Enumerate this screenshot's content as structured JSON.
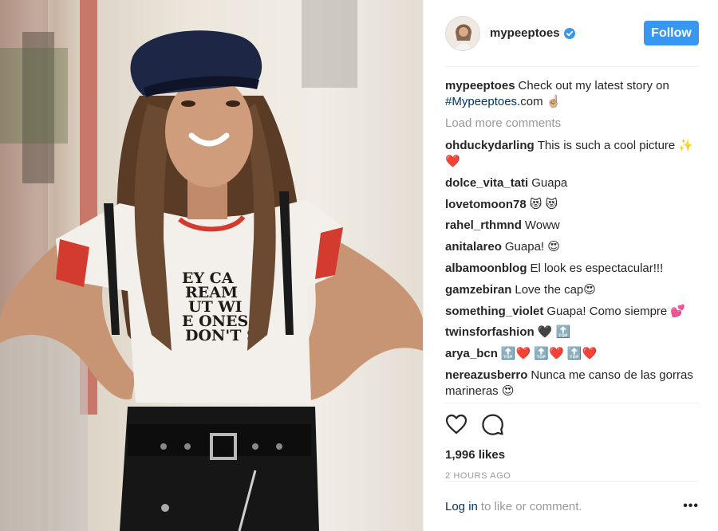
{
  "post": {
    "author": "mypeeptoes",
    "follow_label": "Follow"
  },
  "caption": {
    "username": "mypeeptoes",
    "text_before": "Check out my latest story on",
    "hashtag": "#Mypeeptoes",
    "text_after": ".com ☝🏼"
  },
  "load_more_label": "Load more comments",
  "comments": [
    {
      "username": "ohduckydarling",
      "text": "This is such a cool picture ✨❤️"
    },
    {
      "username": "dolce_vita_tati",
      "text": "Guapa"
    },
    {
      "username": "lovetomoon78",
      "text": "😻 😻"
    },
    {
      "username": "rahel_rthmnd",
      "text": "Woww"
    },
    {
      "username": "anitalareo",
      "text": "Guapa! 😍"
    },
    {
      "username": "albamoonblog",
      "text": "El look es espectacular!!!"
    },
    {
      "username": "gamzebiran",
      "text": "Love the cap😍"
    },
    {
      "username": "something_violet",
      "text": "Guapa! Como siempre 💕"
    },
    {
      "username": "twinsforfashion",
      "text": "🖤 🔝"
    },
    {
      "username": "arya_bcn",
      "text": "🔝❤️ 🔝❤️ 🔝❤️"
    },
    {
      "username": "nereazusberro",
      "text": "Nunca me canso de las gorras marineras 😍"
    }
  ],
  "likes": "1,996 likes",
  "timestamp": "2 HOURS AGO",
  "login": {
    "link": "Log in",
    "rest": "to like or comment."
  },
  "more_label": "•••",
  "shirt_text": [
    "EY CA",
    "REAM",
    "UT WI",
    "E ONES",
    "DON'T S"
  ],
  "colors": {
    "follow_bg": "#3897f0",
    "link": "#003569",
    "muted": "#999999",
    "text": "#262626",
    "verified": "#3897f0"
  },
  "icons": [
    "heart-icon",
    "comment-icon",
    "verified-badge-icon",
    "more-options-icon"
  ]
}
